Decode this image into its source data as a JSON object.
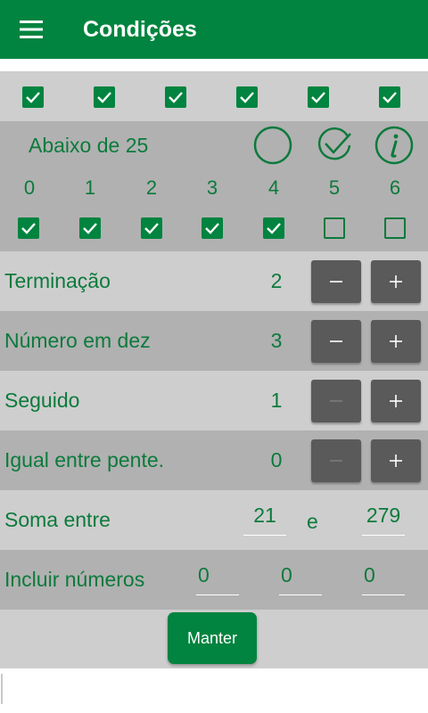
{
  "appbar": {
    "title": "Condições",
    "menu_icon": "hamburger-menu-icon",
    "color": "#00843f"
  },
  "top_checkboxes": [
    true,
    true,
    true,
    true,
    true,
    true
  ],
  "below": {
    "label": "Abaixo de 25",
    "icons": [
      "empty-circle-icon",
      "check-circle-icon",
      "info-circle-icon"
    ],
    "digits": [
      "0",
      "1",
      "2",
      "3",
      "4",
      "5",
      "6"
    ],
    "checks": [
      true,
      true,
      true,
      true,
      true,
      false,
      false
    ]
  },
  "rows": [
    {
      "label": "Terminação",
      "value": "2",
      "minus_enabled": true
    },
    {
      "label": "Número em dez",
      "value": "3",
      "minus_enabled": true
    },
    {
      "label": "Seguido",
      "value": "1",
      "minus_enabled": false
    },
    {
      "label": "Igual entre pente.",
      "value": "0",
      "minus_enabled": false
    }
  ],
  "sum": {
    "label": "Soma entre",
    "from": "21",
    "separator": "e",
    "to": "279"
  },
  "include": {
    "label": "Incluir números",
    "values": [
      "0",
      "0",
      "0"
    ]
  },
  "keep_button": "Manter",
  "colors": {
    "green": "#00843f",
    "text_green": "#0c7a3c",
    "button_gray": "#5a5a5a"
  }
}
